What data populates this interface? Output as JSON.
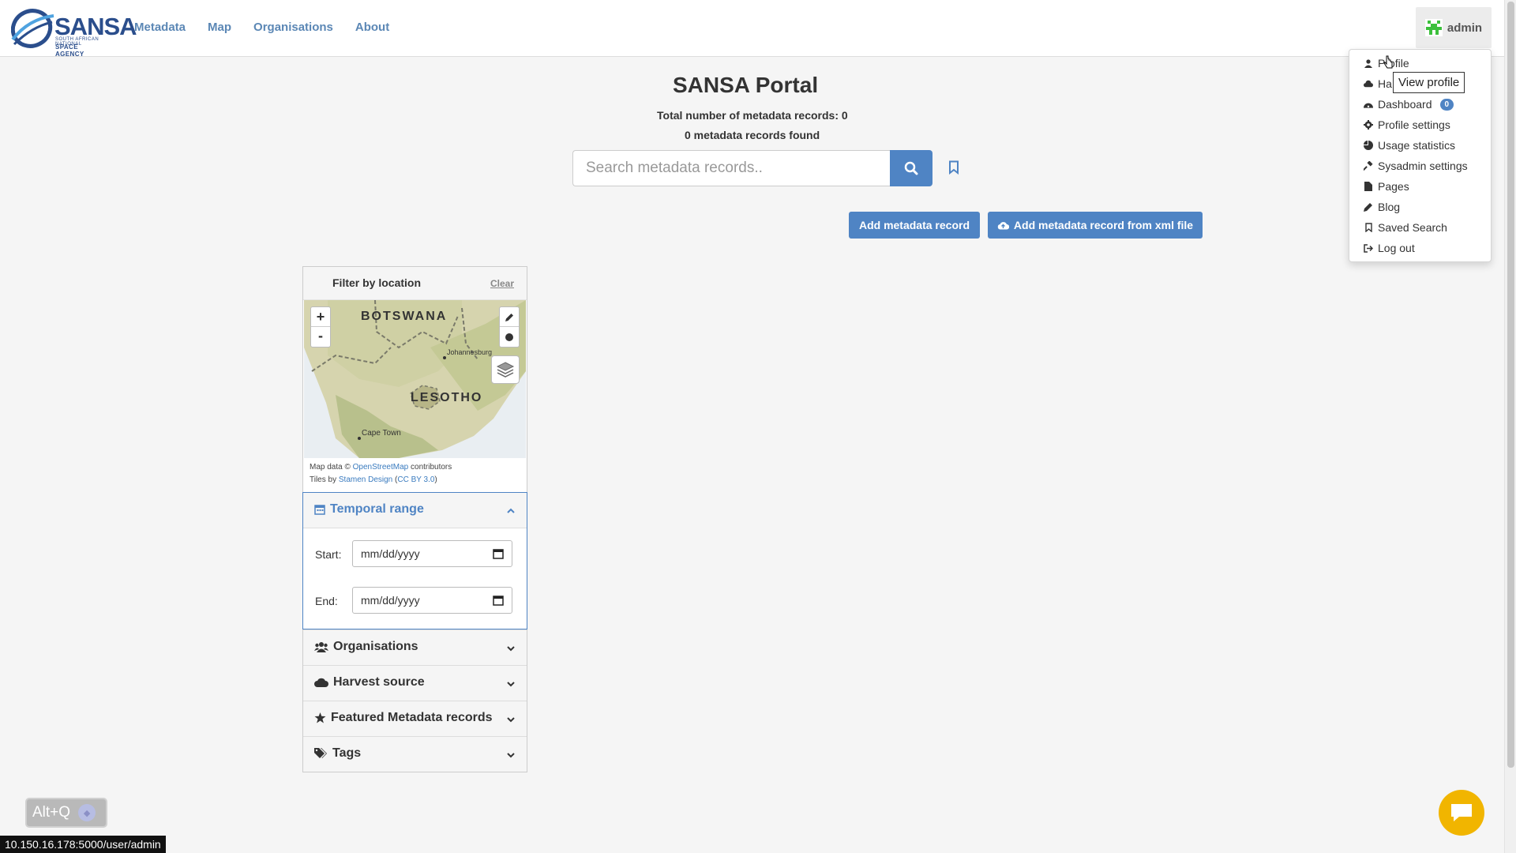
{
  "header": {
    "logo_word": "SANSA",
    "logo_sub1": "SOUTH AFRICAN NATIONAL",
    "logo_sub2": "SPACE AGENCY",
    "nav": [
      "Metadata",
      "Map",
      "Organisations",
      "About"
    ],
    "user_label": "admin"
  },
  "dropdown": {
    "items": [
      "Profile",
      "Ha",
      "Dashboard",
      "Profile settings",
      "Usage statistics",
      "Sysadmin settings",
      "Pages",
      "Blog",
      "Saved Search",
      "Log out"
    ],
    "dashboard_badge": "0",
    "tooltip": "View profile"
  },
  "main": {
    "title": "SANSA Portal",
    "total_records": "Total number of metadata records: 0",
    "found": "0 metadata records found",
    "search_placeholder": "Search metadata records..",
    "add_record": "Add metadata record",
    "add_record_xml": "Add metadata record from xml file"
  },
  "filter": {
    "title": "Filter by location",
    "clear": "Clear",
    "map_labels": [
      "BOTSWANA",
      "Johannesburg",
      "LESOTHO",
      "Cape Town"
    ],
    "zoom_in": "+",
    "zoom_out": "-",
    "attr1_prefix": "Map data © ",
    "attr1_link": "OpenStreetMap",
    "attr1_suffix": " contributors",
    "attr2_prefix": "Tiles by ",
    "attr2_link1": "Stamen Design",
    "attr2_open": " (",
    "attr2_link2": "CC BY 3.0",
    "attr2_close": ")"
  },
  "temporal": {
    "title": "Temporal range",
    "start_label": "Start:",
    "end_label": "End:",
    "start_value": "mm/dd/yyyy",
    "end_value": "mm/dd/yyyy"
  },
  "facets": [
    "Organisations",
    "Harvest source",
    "Featured Metadata records",
    "Tags"
  ],
  "footer": {
    "altq": "Alt+Q",
    "status_url": "10.150.16.178:5000/user/admin"
  }
}
